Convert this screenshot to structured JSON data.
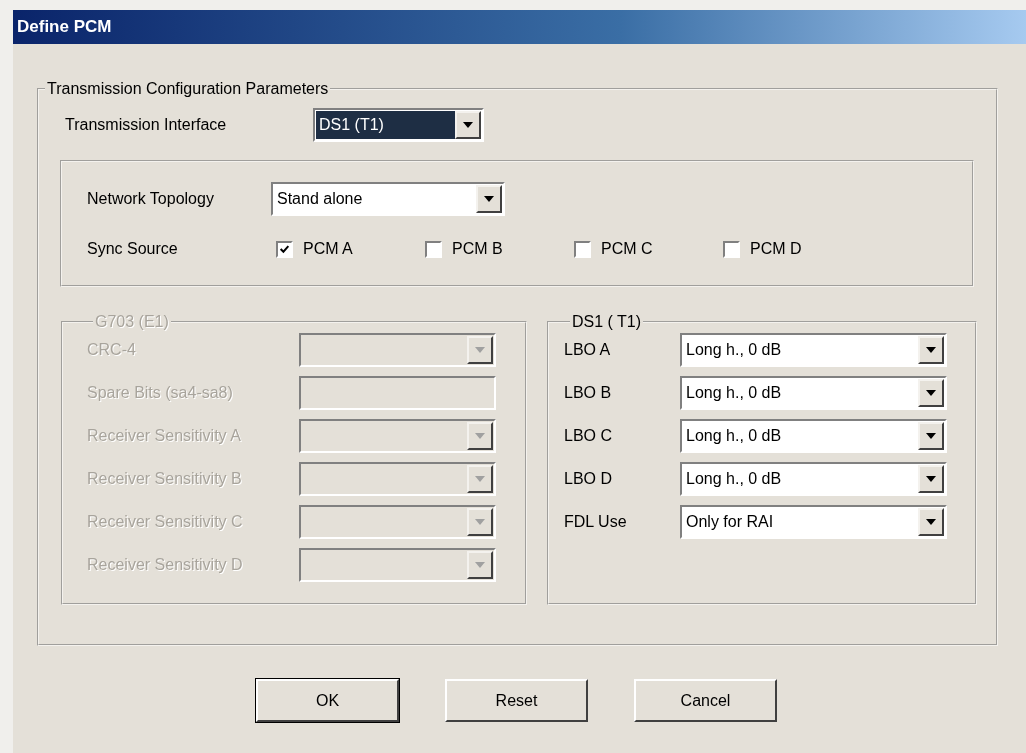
{
  "window": {
    "title": "Define PCM"
  },
  "group": {
    "title": "Transmission Configuration Parameters"
  },
  "transmission_interface": {
    "label": "Transmission Interface",
    "value": "DS1 (T1)",
    "focused": true
  },
  "network_topology": {
    "label": "Network Topology",
    "value": "Stand alone"
  },
  "sync_source": {
    "label": "Sync Source",
    "options": [
      {
        "label": "PCM A",
        "checked": true
      },
      {
        "label": "PCM B",
        "checked": false
      },
      {
        "label": "PCM C",
        "checked": false
      },
      {
        "label": "PCM D",
        "checked": false
      }
    ]
  },
  "g703": {
    "title": "G703 (E1)",
    "disabled": true,
    "fields": [
      {
        "label": "CRC-4",
        "kind": "dropdown"
      },
      {
        "label": "Spare Bits (sa4-sa8)",
        "kind": "text"
      },
      {
        "label": "Receiver Sensitivity A",
        "kind": "dropdown"
      },
      {
        "label": "Receiver Sensitivity B",
        "kind": "dropdown"
      },
      {
        "label": "Receiver Sensitivity C",
        "kind": "dropdown"
      },
      {
        "label": "Receiver Sensitivity D",
        "kind": "dropdown"
      }
    ]
  },
  "ds1": {
    "title": "DS1 ( T1)",
    "disabled": false,
    "fields": [
      {
        "label": "LBO A",
        "kind": "dropdown",
        "value": "Long h.,  0 dB"
      },
      {
        "label": "LBO B",
        "kind": "dropdown",
        "value": "Long h.,  0 dB"
      },
      {
        "label": "LBO C",
        "kind": "dropdown",
        "value": "Long h.,  0 dB"
      },
      {
        "label": "LBO D",
        "kind": "dropdown",
        "value": "Long h.,  0 dB"
      },
      {
        "label": "FDL Use",
        "kind": "dropdown",
        "value": "Only for RAI"
      }
    ]
  },
  "buttons": [
    {
      "label": "OK",
      "default": true
    },
    {
      "label": "Reset",
      "default": false
    },
    {
      "label": "Cancel",
      "default": false
    }
  ]
}
